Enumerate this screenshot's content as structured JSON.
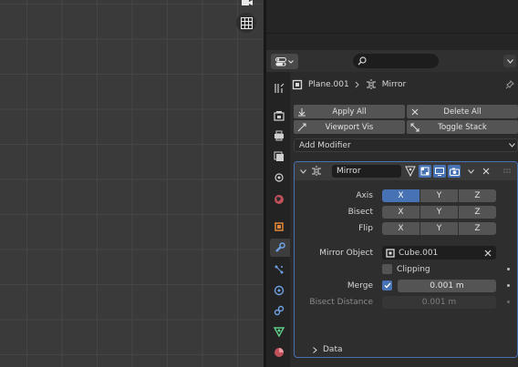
{
  "properties": {
    "breadcrumb": {
      "object": "Plane.001",
      "modifier": "Mirror"
    },
    "operators": {
      "apply_all": "Apply All",
      "delete_all": "Delete All",
      "viewport_vis": "Viewport Vis",
      "toggle_stack": "Toggle Stack"
    },
    "add_modifier": "Add Modifier",
    "modifier": {
      "name": "Mirror",
      "axis_label": "Axis",
      "bisect_label": "Bisect",
      "flip_label": "Flip",
      "x": "X",
      "y": "Y",
      "z": "Z",
      "mirror_object_label": "Mirror Object",
      "mirror_object_value": "Cube.001",
      "clipping_label": "Clipping",
      "merge_label": "Merge",
      "merge_value": "0.001 m",
      "bisect_distance_label": "Bisect Distance",
      "bisect_distance_value": "0.001 m",
      "data_label": "Data"
    }
  },
  "colors": {
    "accent": "#4772b3",
    "panel": "#2e2e2e",
    "viewport": "#3a3a3a"
  }
}
